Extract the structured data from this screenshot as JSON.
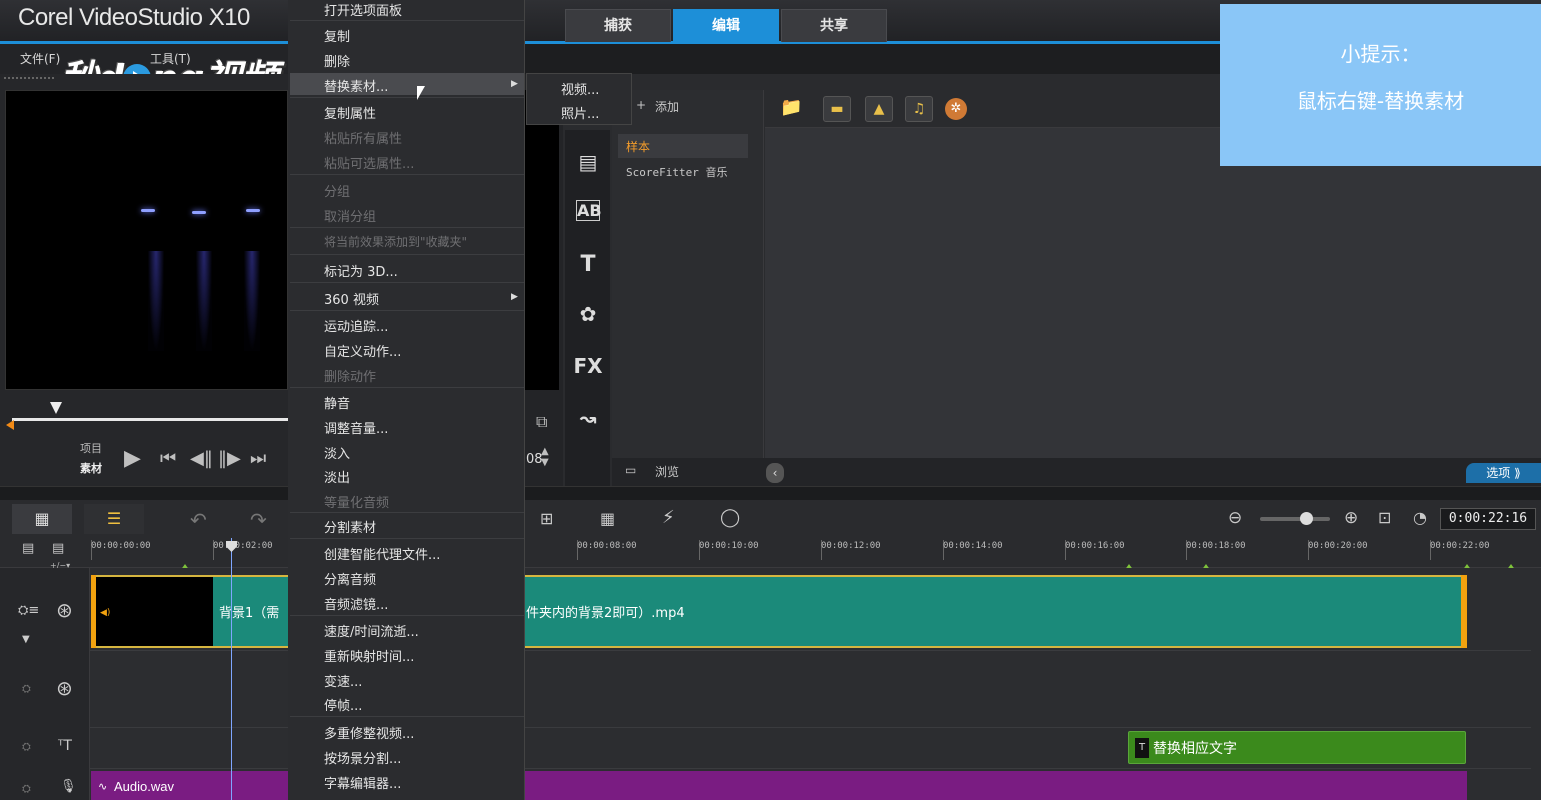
{
  "app": {
    "title": "Corel VideoStudio X10"
  },
  "top_tabs": [
    {
      "label": "捕获",
      "active": false
    },
    {
      "label": "编辑",
      "active": true
    },
    {
      "label": "共享",
      "active": false
    }
  ],
  "menubar": {
    "file": "文件(F)",
    "tools": "工具(T)"
  },
  "watermark": {
    "text_before": "秒d",
    "text_after": "ng视频"
  },
  "preview": {
    "project_label": "项目",
    "clip_label": "素材",
    "timecode_fragment": "08"
  },
  "library": {
    "add_label": "添加",
    "items": [
      {
        "label": "样本",
        "selected": true
      },
      {
        "label": "ScoreFitter 音乐",
        "selected": false
      }
    ],
    "browse_label": "浏览",
    "options_label": "选项",
    "side_icons": [
      "instant-project-icon",
      "transition-icon",
      "title-icon",
      "graphic-icon",
      "filter-icon",
      "path-icon"
    ]
  },
  "tip": {
    "line1": "小提示：",
    "line2": "鼠标右键-替换素材"
  },
  "context_menu": {
    "items": [
      {
        "label": "打开选项面板",
        "enabled": true
      },
      {
        "label": "复制",
        "enabled": true
      },
      {
        "label": "删除",
        "enabled": true
      },
      {
        "label": "替换素材...",
        "enabled": true,
        "submenu": true,
        "highlighted": true
      },
      {
        "label": "复制属性",
        "enabled": true
      },
      {
        "label": "粘贴所有属性",
        "enabled": false
      },
      {
        "label": "粘贴可选属性...",
        "enabled": false
      },
      {
        "label": "分组",
        "enabled": false
      },
      {
        "label": "取消分组",
        "enabled": false
      },
      {
        "label": "将当前效果添加到\"收藏夹\"",
        "enabled": false
      },
      {
        "label": "标记为 3D...",
        "enabled": true
      },
      {
        "label": "360 视频",
        "enabled": true,
        "submenu": true
      },
      {
        "label": "运动追踪...",
        "enabled": true
      },
      {
        "label": "自定义动作...",
        "enabled": true
      },
      {
        "label": "删除动作",
        "enabled": false
      },
      {
        "label": "静音",
        "enabled": true
      },
      {
        "label": "调整音量...",
        "enabled": true
      },
      {
        "label": "淡入",
        "enabled": true
      },
      {
        "label": "淡出",
        "enabled": true
      },
      {
        "label": "等量化音频",
        "enabled": false
      },
      {
        "label": "分割素材",
        "enabled": true
      },
      {
        "label": "创建智能代理文件...",
        "enabled": true
      },
      {
        "label": "分离音频",
        "enabled": true
      },
      {
        "label": "音频滤镜...",
        "enabled": true
      },
      {
        "label": "速度/时间流逝...",
        "enabled": true
      },
      {
        "label": "重新映射时间...",
        "enabled": true
      },
      {
        "label": "变速...",
        "enabled": true
      },
      {
        "label": "停帧...",
        "enabled": true
      },
      {
        "label": "多重修整视频...",
        "enabled": true
      },
      {
        "label": "按场景分割...",
        "enabled": true
      },
      {
        "label": "字幕编辑器...",
        "enabled": true
      }
    ],
    "submenu": [
      {
        "label": "视频..."
      },
      {
        "label": "照片..."
      }
    ]
  },
  "timeline": {
    "timecode": "0:00:22:16",
    "ruler_ticks": [
      "00:00:00:00",
      "00:00:02:00",
      "00:00:08:00",
      "00:00:10:00",
      "00:00:12:00",
      "00:00:14:00",
      "00:00:16:00",
      "00:00:18:00",
      "00:00:20:00",
      "00:00:22:00"
    ],
    "video_clip_label_left": "背景1（需",
    "video_clip_label_right": "件夹内的背景2即可）.mp4",
    "title_clip_label": "替换相应文字",
    "audio_clip_label": "Audio.wav"
  }
}
